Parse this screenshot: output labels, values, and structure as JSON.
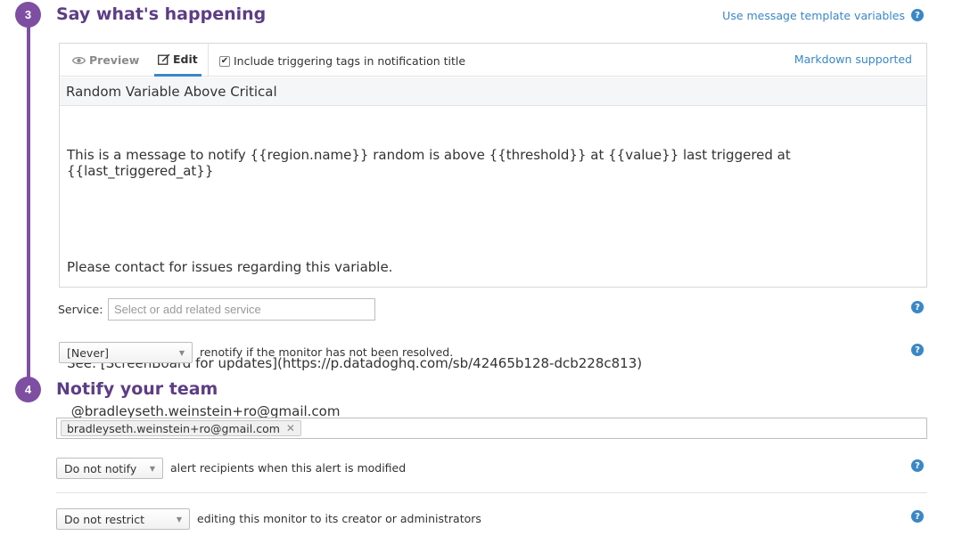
{
  "steps": {
    "step3": {
      "number": "3",
      "title": "Say what's happening"
    },
    "step4": {
      "number": "4",
      "title": "Notify your team"
    }
  },
  "template_vars_link": "Use message template variables",
  "editor": {
    "tabs": {
      "preview": "Preview",
      "edit": "Edit"
    },
    "include_tags_label": "Include triggering tags in notification title",
    "include_tags_checked": true,
    "markdown_link": "Markdown supported",
    "title_value": "Random Variable Above Critical",
    "body_lines": [
      "This is a message to notify {{region.name}} random is above {{threshold}} at {{value}} last triggered at {{last_triggered_at}}",
      "",
      "Please contact for issues regarding this variable.",
      "",
      "See: [ScreenBoard for updates](https://p.datadoghq.com/sb/42465b128-dcb228c813)",
      " @bradleyseth.weinstein+ro@gmail.com"
    ]
  },
  "service": {
    "label": "Service:",
    "placeholder": "Select or add related service"
  },
  "renotify": {
    "selected": "[Never]",
    "text": "renotify if the monitor has not been resolved."
  },
  "recipients": {
    "tag": "bradleyseth.weinstein+ro@gmail.com"
  },
  "notify_modified": {
    "selected": "Do not notify",
    "text": "alert recipients when this alert is modified"
  },
  "restrict": {
    "selected": "Do not restrict",
    "text": "editing this monitor to its creator or administrators"
  },
  "help_glyph": "?",
  "colors": {
    "accent_purple": "#7e4ea3",
    "title_purple": "#5d3d85",
    "link_blue": "#3a87c6"
  }
}
